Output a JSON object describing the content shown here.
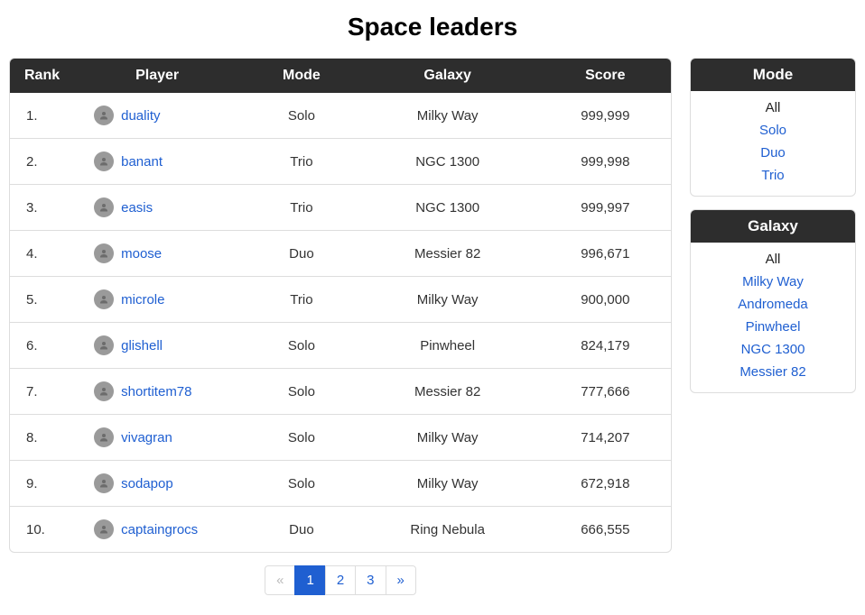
{
  "title": "Space leaders",
  "columns": {
    "rank": "Rank",
    "player": "Player",
    "mode": "Mode",
    "galaxy": "Galaxy",
    "score": "Score"
  },
  "rows": [
    {
      "rank": "1.",
      "player": "duality",
      "mode": "Solo",
      "galaxy": "Milky Way",
      "score": "999,999"
    },
    {
      "rank": "2.",
      "player": "banant",
      "mode": "Trio",
      "galaxy": "NGC 1300",
      "score": "999,998"
    },
    {
      "rank": "3.",
      "player": "easis",
      "mode": "Trio",
      "galaxy": "NGC 1300",
      "score": "999,997"
    },
    {
      "rank": "4.",
      "player": "moose",
      "mode": "Duo",
      "galaxy": "Messier 82",
      "score": "996,671"
    },
    {
      "rank": "5.",
      "player": "microle",
      "mode": "Trio",
      "galaxy": "Milky Way",
      "score": "900,000"
    },
    {
      "rank": "6.",
      "player": "glishell",
      "mode": "Solo",
      "galaxy": "Pinwheel",
      "score": "824,179"
    },
    {
      "rank": "7.",
      "player": "shortitem78",
      "mode": "Solo",
      "galaxy": "Messier 82",
      "score": "777,666"
    },
    {
      "rank": "8.",
      "player": "vivagran",
      "mode": "Solo",
      "galaxy": "Milky Way",
      "score": "714,207"
    },
    {
      "rank": "9.",
      "player": "sodapop",
      "mode": "Solo",
      "galaxy": "Milky Way",
      "score": "672,918"
    },
    {
      "rank": "10.",
      "player": "captaingrocs",
      "mode": "Duo",
      "galaxy": "Ring Nebula",
      "score": "666,555"
    }
  ],
  "filters": {
    "mode": {
      "title": "Mode",
      "items": [
        {
          "label": "All",
          "active": true
        },
        {
          "label": "Solo",
          "active": false
        },
        {
          "label": "Duo",
          "active": false
        },
        {
          "label": "Trio",
          "active": false
        }
      ]
    },
    "galaxy": {
      "title": "Galaxy",
      "items": [
        {
          "label": "All",
          "active": true
        },
        {
          "label": "Milky Way",
          "active": false
        },
        {
          "label": "Andromeda",
          "active": false
        },
        {
          "label": "Pinwheel",
          "active": false
        },
        {
          "label": "NGC 1300",
          "active": false
        },
        {
          "label": "Messier 82",
          "active": false
        }
      ]
    }
  },
  "pager": {
    "prev": "«",
    "next": "»",
    "pages": [
      "1",
      "2",
      "3"
    ],
    "active_index": 0,
    "prev_disabled": true,
    "next_disabled": false
  }
}
